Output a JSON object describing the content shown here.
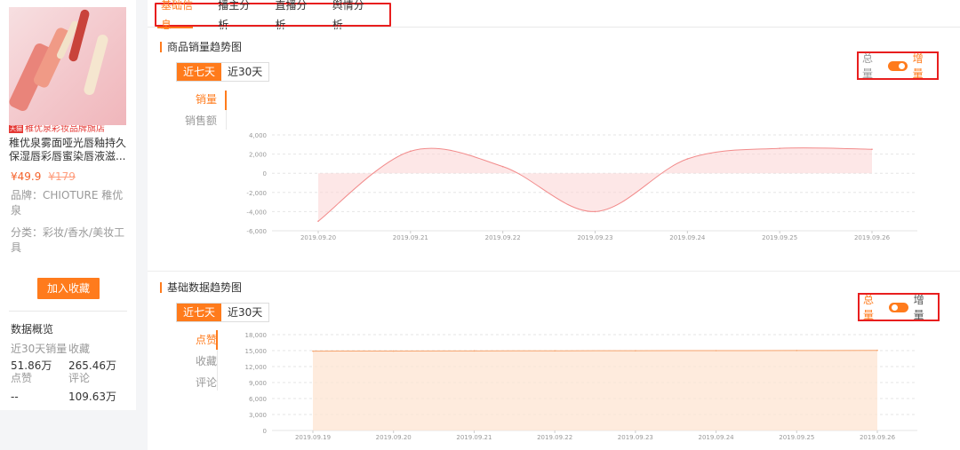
{
  "product": {
    "store_tag": "天猫",
    "store_name": "稚优泉彩妆品牌旗店",
    "title": "稚优泉雾面哑光唇釉持久保湿唇彩唇蜜染唇液滋...",
    "price": "¥49.9",
    "original_price": "¥179",
    "brand": "品牌：CHIOTURE 稚优泉",
    "category": "分类：彩妆/香水/美妆工具",
    "fav_button": "加入收藏"
  },
  "overview": {
    "title": "数据概览",
    "rows": [
      [
        "近30天销量",
        "收藏"
      ],
      [
        "51.86万",
        "265.46万"
      ],
      [
        "点赞",
        "评论"
      ],
      [
        "--",
        "109.63万"
      ]
    ]
  },
  "tabs": [
    "基础信息",
    "播主分析",
    "直播分析",
    "舆情分析"
  ],
  "sales_section": {
    "title": "商品销量趋势图",
    "ranges": [
      "近七天",
      "近30天"
    ],
    "metrics": [
      "销量",
      "销售额"
    ],
    "toggle": {
      "left": "总量",
      "right": "增量",
      "state": "增量"
    }
  },
  "basic_section": {
    "title": "基础数据趋势图",
    "ranges": [
      "近七天",
      "近30天"
    ],
    "metrics": [
      "点赞",
      "收藏",
      "评论"
    ],
    "toggle": {
      "left": "总量",
      "right": "增量",
      "state": "总量"
    }
  },
  "colors": {
    "accent": "#ff7b1c",
    "highlight_red": "#e81e1e",
    "sales_line": "#f28b8b",
    "basic_line": "#f5a26b"
  },
  "chart_data": [
    {
      "type": "area",
      "x": [
        "2019.09.20",
        "2019.09.21",
        "2019.09.22",
        "2019.09.23",
        "2019.09.24",
        "2019.09.25",
        "2019.09.26"
      ],
      "ylim": [
        -6000,
        4000
      ],
      "yticks": [
        "4,000",
        "2,000",
        "0",
        "-2,000",
        "-4,000",
        "-6,000"
      ],
      "series": [
        {
          "values": [
            -5000,
            2300,
            700,
            -4000,
            1500,
            2600,
            2500
          ]
        }
      ]
    },
    {
      "type": "area",
      "x": [
        "2019.09.19",
        "2019.09.20",
        "2019.09.21",
        "2019.09.22",
        "2019.09.23",
        "2019.09.24",
        "2019.09.25",
        "2019.09.26"
      ],
      "ylim": [
        0,
        18000
      ],
      "yticks": [
        "18,000",
        "15,000",
        "12,000",
        "9,000",
        "6,000",
        "3,000",
        "0"
      ],
      "series": [
        {
          "values": [
            14900,
            14920,
            14940,
            14960,
            14980,
            15000,
            15020,
            15050
          ]
        }
      ]
    }
  ]
}
